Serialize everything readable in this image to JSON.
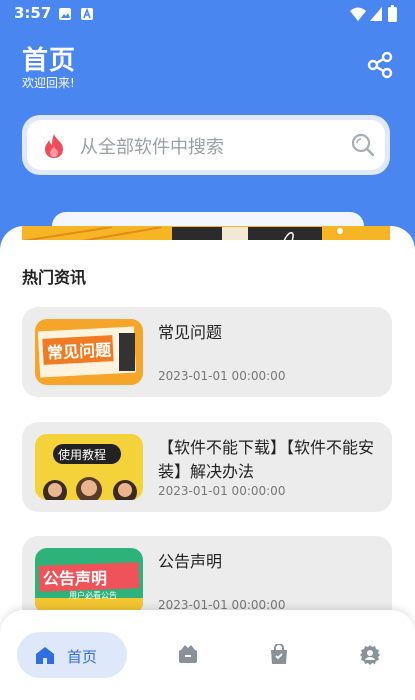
{
  "status_bar": {
    "time": "3:57"
  },
  "header": {
    "title": "首页",
    "subtitle": "欢迎回来!"
  },
  "search": {
    "placeholder": "从全部软件中搜索"
  },
  "news": {
    "section_title": "热门资讯",
    "items": [
      {
        "title": "常见问题",
        "date": "2023-01-01 00:00:00",
        "thumb_text": "常见问题"
      },
      {
        "title": "【软件不能下载】【软件不能安装】解决办法",
        "date": "2023-01-01 00:00:00",
        "thumb_text": "使用教程"
      },
      {
        "title": "公告声明",
        "date": "2023-01-01 00:00:00",
        "thumb_text": "公告声明",
        "thumb_subtext": "用户必看公告"
      }
    ]
  },
  "bottom_nav": {
    "home_label": "首页",
    "icons": [
      "home-icon",
      "store-icon",
      "bag-icon",
      "profile-icon"
    ]
  },
  "colors": {
    "primary": "#4a86f0",
    "card_bg": "#ececec",
    "nav_active_bg": "#dfe8fb",
    "nav_active_text": "#2f6de1"
  }
}
